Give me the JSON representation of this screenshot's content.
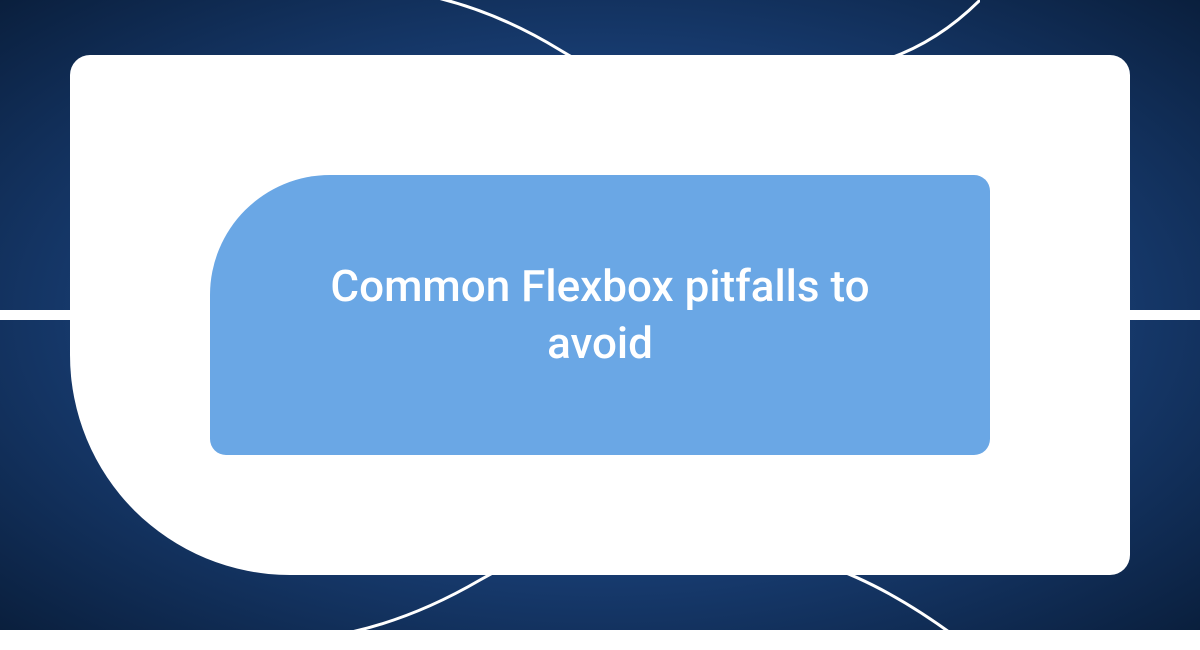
{
  "card": {
    "title": "Common Flexbox pitfalls to avoid"
  },
  "colors": {
    "background_dark": "#0a1f3d",
    "background_mid": "#1e4a8a",
    "background_light": "#3d6db5",
    "inner_panel": "#6aa7e5",
    "outer_panel": "#ffffff",
    "text": "#ffffff"
  }
}
